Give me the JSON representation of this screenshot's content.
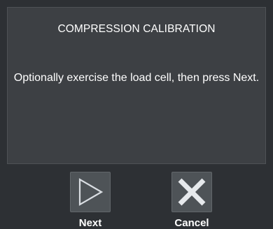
{
  "dialog": {
    "title": "COMPRESSION CALIBRATION",
    "message": "Optionally exercise the load cell, then press Next."
  },
  "buttons": {
    "next": {
      "label": "Next",
      "icon": "play-triangle-icon"
    },
    "cancel": {
      "label": "Cancel",
      "icon": "close-x-icon"
    }
  },
  "colors": {
    "background": "#2d3034",
    "panel": "#3d4044",
    "button": "#4e5357",
    "text": "#ffffff",
    "icon": "#d9dde2"
  }
}
